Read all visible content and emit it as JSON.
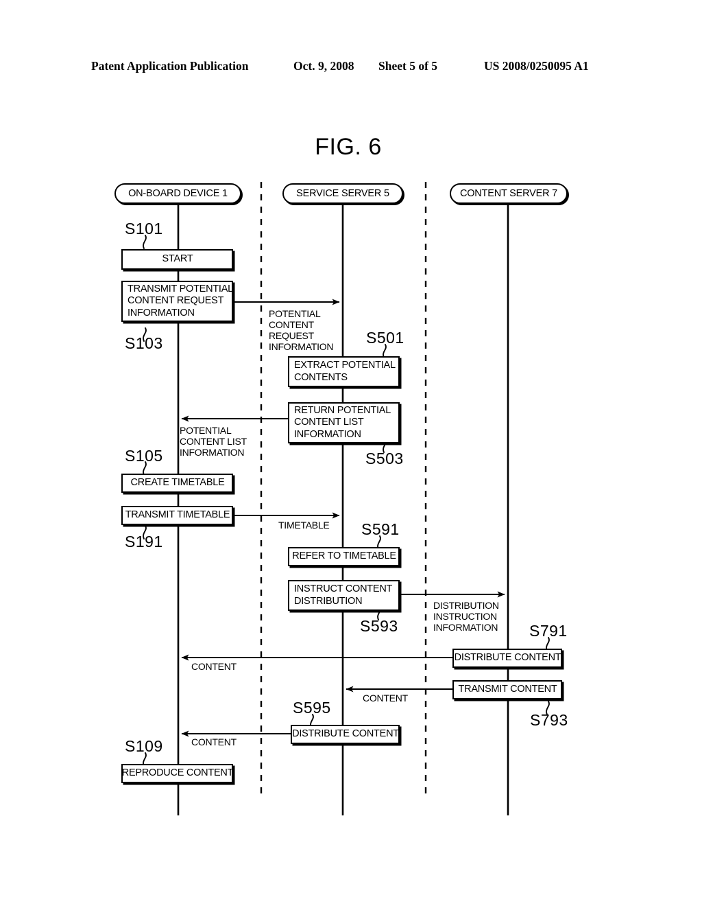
{
  "header": {
    "publication": "Patent Application Publication",
    "date": "Oct. 9, 2008",
    "sheet": "Sheet 5 of 5",
    "patent_number": "US 2008/0250095 A1"
  },
  "figure": {
    "title": "FIG. 6"
  },
  "actors": [
    {
      "id": "on-board-device",
      "label": "ON-BOARD DEVICE 1"
    },
    {
      "id": "service-server",
      "label": "SERVICE SERVER 5"
    },
    {
      "id": "content-server",
      "label": "CONTENT SERVER 7"
    }
  ],
  "steps": [
    {
      "id": "S101",
      "label": "S101",
      "box": [
        "START"
      ]
    },
    {
      "id": "S103",
      "label": "S103",
      "box": [
        "TRANSMIT POTENTIAL",
        "CONTENT REQUEST",
        "INFORMATION"
      ]
    },
    {
      "id": "S501",
      "label": "S501",
      "box": [
        "EXTRACT POTENTIAL",
        "CONTENTS"
      ]
    },
    {
      "id": "S503",
      "label": "S503",
      "box": [
        "RETURN POTENTIAL",
        "CONTENT LIST",
        "INFORMATION"
      ]
    },
    {
      "id": "S105",
      "label": "S105",
      "box": [
        "CREATE TIMETABLE"
      ]
    },
    {
      "id": "S191",
      "label": "S191",
      "box": [
        "TRANSMIT TIMETABLE"
      ]
    },
    {
      "id": "S591",
      "label": "S591",
      "box": [
        "REFER TO TIMETABLE"
      ]
    },
    {
      "id": "S593",
      "label": "S593",
      "box": [
        "INSTRUCT CONTENT",
        "DISTRIBUTION"
      ]
    },
    {
      "id": "S791",
      "label": "S791",
      "box": [
        "DISTRIBUTE CONTENT"
      ]
    },
    {
      "id": "S793",
      "label": "S793",
      "box": [
        "TRANSMIT CONTENT"
      ]
    },
    {
      "id": "S595",
      "label": "S595",
      "box": [
        "DISTRIBUTE CONTENT"
      ]
    },
    {
      "id": "S109",
      "label": "S109",
      "box": [
        "REPRODUCE CONTENT"
      ]
    }
  ],
  "messages": [
    {
      "id": "potential-content-request-information",
      "lines": [
        "POTENTIAL",
        "CONTENT",
        "REQUEST",
        "INFORMATION"
      ],
      "direction": "right"
    },
    {
      "id": "potential-content-list-information",
      "lines": [
        "POTENTIAL",
        "CONTENT LIST",
        "INFORMATION"
      ],
      "direction": "left"
    },
    {
      "id": "timetable",
      "lines": [
        "TIMETABLE"
      ],
      "direction": "right"
    },
    {
      "id": "distribution-instruction-information",
      "lines": [
        "DISTRIBUTION",
        "INSTRUCTION",
        "INFORMATION"
      ],
      "direction": "right"
    },
    {
      "id": "content-server-to-device",
      "lines": [
        "CONTENT"
      ],
      "direction": "left"
    },
    {
      "id": "content-server-to-service",
      "lines": [
        "CONTENT"
      ],
      "direction": "left"
    },
    {
      "id": "content-service-to-device",
      "lines": [
        "CONTENT"
      ],
      "direction": "left"
    }
  ],
  "box_text": {
    "start": "START",
    "transmit_potential_1": "TRANSMIT POTENTIAL",
    "transmit_potential_2": "CONTENT REQUEST",
    "transmit_potential_3": "INFORMATION",
    "extract_1": "EXTRACT POTENTIAL",
    "extract_2": "CONTENTS",
    "return_1": "RETURN POTENTIAL",
    "return_2": "CONTENT LIST",
    "return_3": "INFORMATION",
    "create_timetable": "CREATE TIMETABLE",
    "transmit_timetable": "TRANSMIT TIMETABLE",
    "refer_timetable": "REFER TO TIMETABLE",
    "instruct_1": "INSTRUCT CONTENT",
    "instruct_2": "DISTRIBUTION",
    "distribute_content_7": "DISTRIBUTE CONTENT",
    "transmit_content_7": "TRANSMIT CONTENT",
    "distribute_content_5": "DISTRIBUTE CONTENT",
    "reproduce_content": "REPRODUCE CONTENT"
  },
  "msg_text": {
    "pcri_1": "POTENTIAL",
    "pcri_2": "CONTENT",
    "pcri_3": "REQUEST",
    "pcri_4": "INFORMATION",
    "pcli_1": "POTENTIAL",
    "pcli_2": "CONTENT LIST",
    "pcli_3": "INFORMATION",
    "timetable": "TIMETABLE",
    "dii_1": "DISTRIBUTION",
    "dii_2": "INSTRUCTION",
    "dii_3": "INFORMATION",
    "content_a": "CONTENT",
    "content_b": "CONTENT",
    "content_c": "CONTENT"
  },
  "step_labels": {
    "s101": "S101",
    "s103": "S103",
    "s501": "S501",
    "s503": "S503",
    "s105": "S105",
    "s191": "S191",
    "s591": "S591",
    "s593": "S593",
    "s791": "S791",
    "s793": "S793",
    "s595": "S595",
    "s109": "S109"
  },
  "colors": {
    "ink": "#000000",
    "paper": "#ffffff"
  }
}
